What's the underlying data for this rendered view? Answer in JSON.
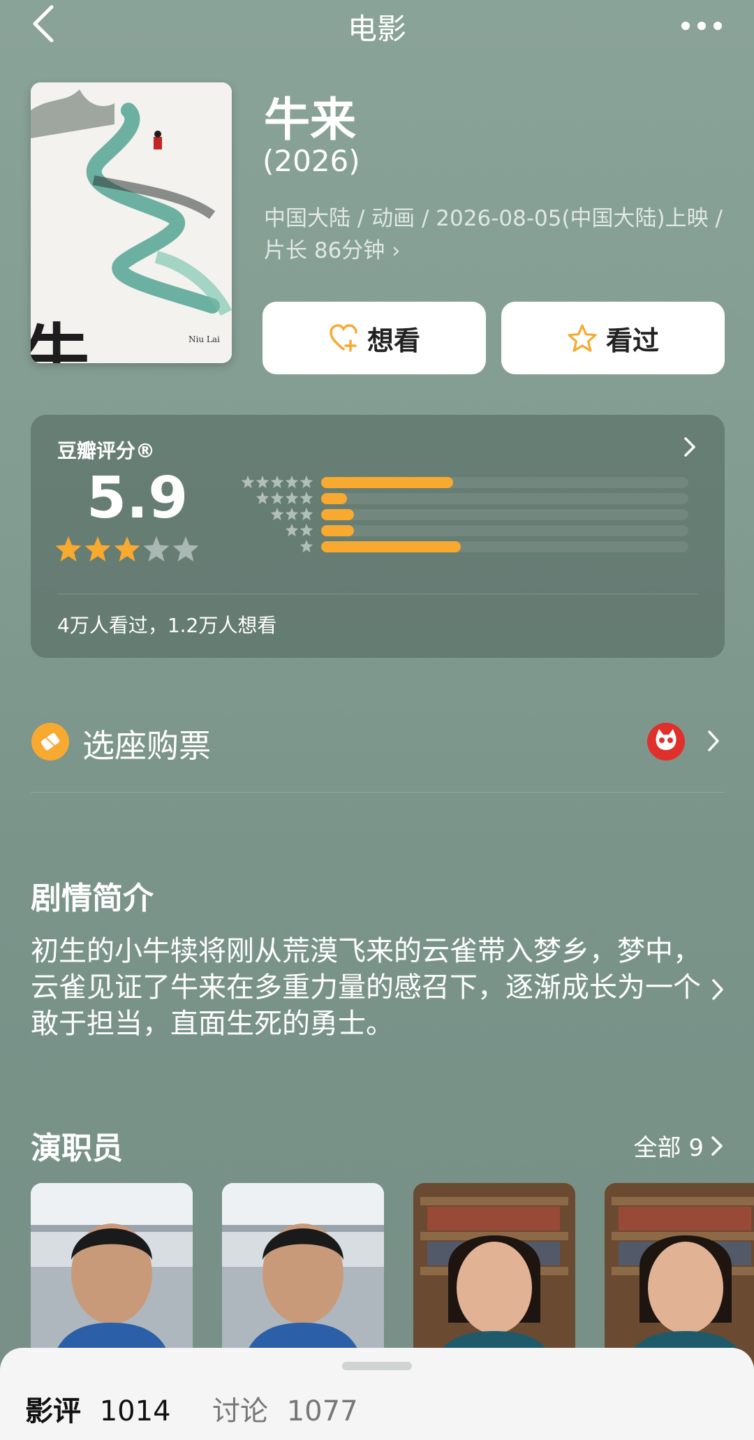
{
  "header": {
    "title": "电影",
    "back_icon": "back-arrow-icon",
    "more_icon": "more-dots-icon"
  },
  "movie": {
    "title": "牛来",
    "year": "(2026)",
    "meta_line1": "中国大陆 / 动画 / 2026-08-05(中国大陆)上映 /",
    "meta_line2": "片长 86分钟 ›",
    "poster_text": "牛来",
    "poster_subtitle": "Niu Lai"
  },
  "actions": {
    "want_label": "想看",
    "seen_label": "看过"
  },
  "rating": {
    "label": "豆瓣评分®",
    "score": "5.9",
    "stars": 3,
    "distribution": [
      {
        "stars": 5,
        "fraction": 0.36
      },
      {
        "stars": 4,
        "fraction": 0.07
      },
      {
        "stars": 3,
        "fraction": 0.09
      },
      {
        "stars": 2,
        "fraction": 0.09
      },
      {
        "stars": 1,
        "fraction": 0.38
      }
    ],
    "counts": "4万人看过，1.2万人想看"
  },
  "ticket": {
    "label": "选座购票"
  },
  "synopsis": {
    "title": "剧情简介",
    "text": "初生的小牛犊将刚从荒漠飞来的云雀带入梦乡，梦中，云雀见证了牛来在多重力量的感召下，逐渐成长为一个敢于担当，直面生死的勇士。"
  },
  "cast": {
    "title": "演职员",
    "all_label": "全部 9"
  },
  "bottom_tabs": [
    {
      "label": "影评",
      "count": "1014"
    },
    {
      "label": "讨论",
      "count": "1077"
    }
  ],
  "colors": {
    "accent": "#f8a930",
    "background": "#829c91"
  }
}
